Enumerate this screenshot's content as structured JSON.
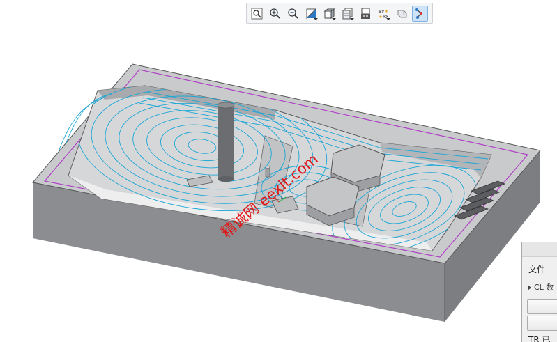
{
  "toolbar": {
    "buttons": [
      {
        "name": "zoom-fit-icon"
      },
      {
        "name": "zoom-in-icon"
      },
      {
        "name": "zoom-out-icon"
      },
      {
        "name": "display-style-icon"
      },
      {
        "name": "saved-views-icon"
      },
      {
        "name": "section-view-icon"
      },
      {
        "name": "appearance-icon"
      },
      {
        "name": "datum-display-icon"
      },
      {
        "name": "spin-center-icon"
      },
      {
        "name": "toolpath-display-icon",
        "active": true
      }
    ]
  },
  "watermark": "精诚网 eexit.com",
  "panel": {
    "menu_file": "文件",
    "tree_item": "CL 数",
    "bottom_label": "TR 已"
  },
  "colors": {
    "toolpath": "#1aa6d6",
    "boundary": "#b040c8",
    "stock": "#8c8e91",
    "watermark": "#e01818",
    "active_button": "#cde3f7"
  }
}
